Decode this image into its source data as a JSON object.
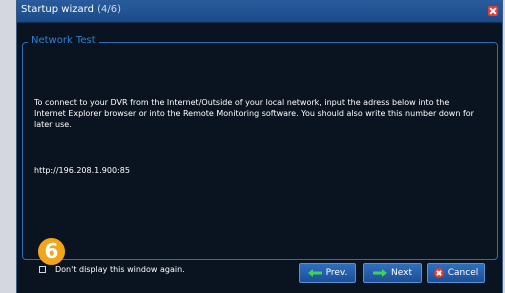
{
  "window": {
    "title": "Startup wizard",
    "step": "(4/6)"
  },
  "section": {
    "legend": "Network Test"
  },
  "content": {
    "description": "To connect to your DVR from the Internet/Outside of your local network, input the adress below into the Internet Explorer browser or into the Remote Monitoring software. You should also write this number down for later use.",
    "url": "http://196.208.1.900:85"
  },
  "callout": {
    "number": "6"
  },
  "footer": {
    "checkbox_label": "Don't display this window again.",
    "prev_label": "Prev.",
    "next_label": "Next",
    "cancel_label": "Cancel"
  },
  "colors": {
    "accent": "#2b6fb6",
    "arrow": "#3fd15a",
    "close": "#e6392f",
    "badge": "#f2a51a"
  },
  "icons": {
    "close": "close-icon",
    "prev": "left-arrow-icon",
    "next": "right-arrow-icon",
    "cancel": "cancel-x-icon"
  }
}
